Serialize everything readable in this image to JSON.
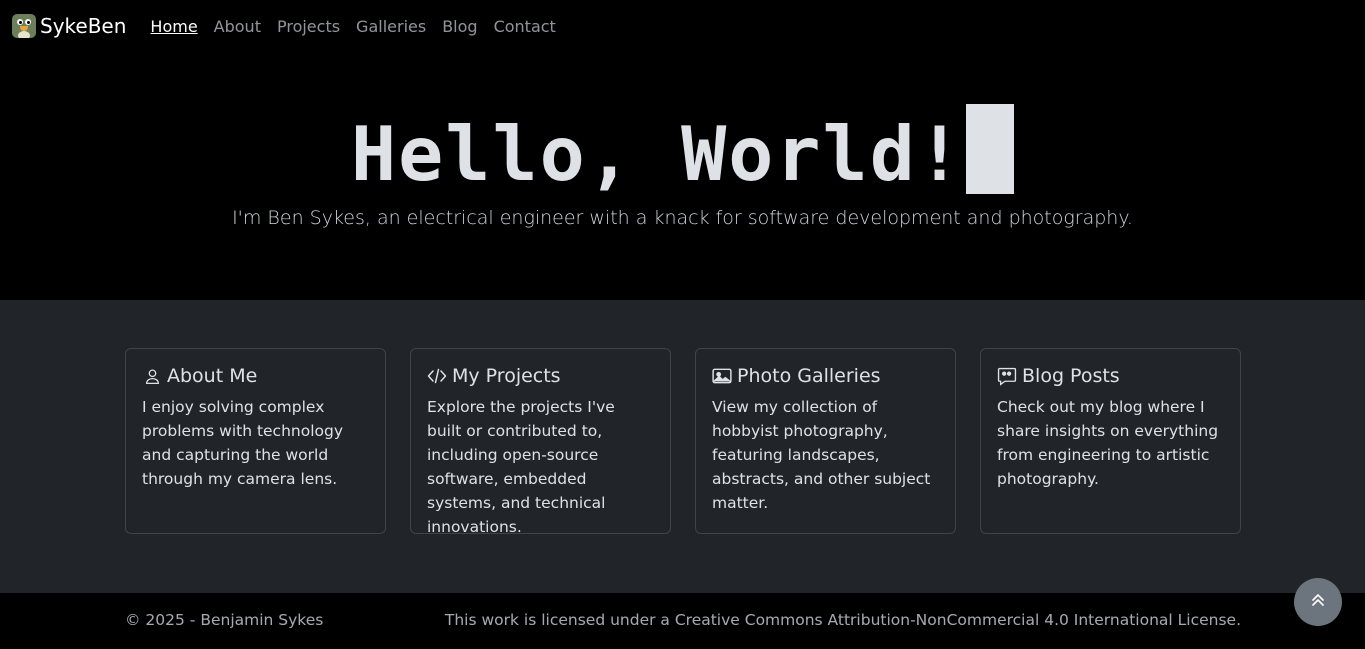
{
  "nav": {
    "brand": "SykeBen",
    "links": [
      "Home",
      "About",
      "Projects",
      "Galleries",
      "Blog",
      "Contact"
    ],
    "active": "Home"
  },
  "hero": {
    "title": "Hello, World!",
    "subtitle": "I'm Ben Sykes, an electrical engineer with a knack for software development and photography."
  },
  "cards": [
    {
      "icon": "person-icon",
      "title": "About Me",
      "text": "I enjoy solving complex problems with technology and capturing the world through my camera lens."
    },
    {
      "icon": "code-icon",
      "title": "My Projects",
      "text": "Explore the projects I've built or contributed to, including open-source software, embedded systems, and technical innovations."
    },
    {
      "icon": "image-icon",
      "title": "Photo Galleries",
      "text": "View my collection of hobbyist photography, featuring landscapes, abstracts, and other subject matter."
    },
    {
      "icon": "quote-bubble-icon",
      "title": "Blog Posts",
      "text": "Check out my blog where I share insights on everything from engineering to artistic photography."
    }
  ],
  "footer": {
    "copyright": "© 2025 - Benjamin Sykes",
    "license": "This work is licensed under a Creative Commons Attribution-NonCommercial 4.0 International License."
  },
  "colors": {
    "page_bg": "#000000",
    "section_bg": "#212529",
    "card_border": "#3f444a",
    "to_top_bg": "#6c757d"
  }
}
